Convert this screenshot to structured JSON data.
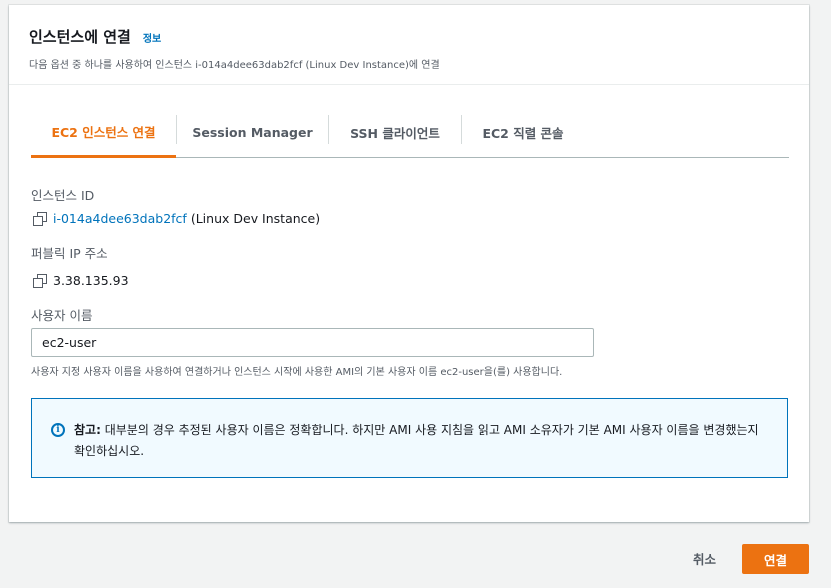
{
  "header": {
    "title": "인스턴스에 연결",
    "info_link": "정보",
    "subtitle": "다음 옵션 중 하나를 사용하여 인스턴스 i-014a4dee63dab2fcf (Linux Dev Instance)에 연결"
  },
  "tabs": [
    {
      "label": "EC2 인스턴스 연결",
      "active": true
    },
    {
      "label": "Session Manager",
      "active": false
    },
    {
      "label": "SSH 클라이언트",
      "active": false
    },
    {
      "label": "EC2 직렬 콘솔",
      "active": false
    }
  ],
  "instance": {
    "label": "인스턴스 ID",
    "id": "i-014a4dee63dab2fcf",
    "name": "(Linux Dev Instance)"
  },
  "public_ip": {
    "label": "퍼블릭 IP 주소",
    "value": "3.38.135.93"
  },
  "username": {
    "label": "사용자 이름",
    "value": "ec2-user",
    "hint": "사용자 지정 사용자 이름을 사용하여 연결하거나 인스턴스 시작에 사용한 AMI의 기본 사용자 이름 ec2-user을(를) 사용합니다."
  },
  "alert": {
    "icon": "info-icon",
    "prefix": "참고:",
    "text": "대부분의 경우 추정된 사용자 이름은 정확합니다. 하지만 AMI 사용 지침을 읽고 AMI 소유자가 기본 AMI 사용자 이름을 변경했는지 확인하십시오."
  },
  "footer": {
    "cancel": "취소",
    "connect": "연결"
  },
  "colors": {
    "accent": "#ec7211",
    "link": "#0073bb",
    "info_bg": "#f1faff"
  }
}
